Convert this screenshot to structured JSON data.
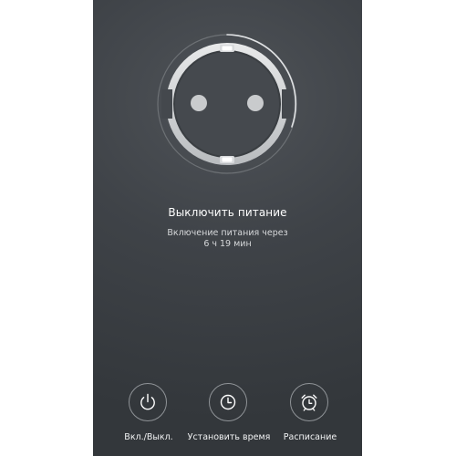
{
  "status": {
    "title": "Выключить питание",
    "subtitle_line1": "Включение питания через",
    "subtitle_line2": "6 ч 19 мин"
  },
  "actions": [
    {
      "label": "Вкл./Выкл.",
      "icon": "power-icon"
    },
    {
      "label": "Установить время",
      "icon": "clock-icon"
    },
    {
      "label": "Расписание",
      "icon": "alarm-clock-icon"
    }
  ],
  "colors": {
    "background_top": "#4f5358",
    "background_bottom": "#33373b",
    "socket_gray": "#c9cbcd",
    "text_primary": "#ffffff",
    "text_secondary": "#d6d8da"
  }
}
